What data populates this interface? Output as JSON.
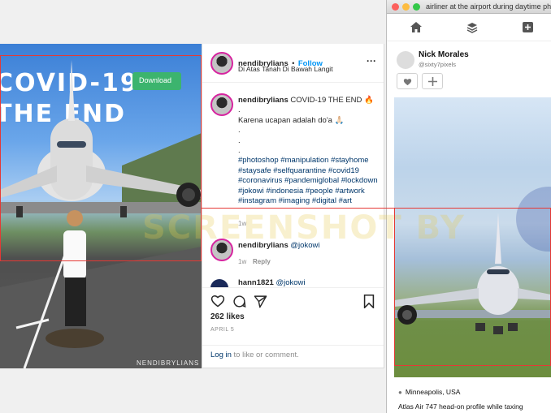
{
  "instagram": {
    "image_title_line1": "COVID-19",
    "image_title_line2": "THE END",
    "image_watermark": "NENDIBRYLIANS",
    "header": {
      "username": "nendibrylians",
      "follow_label": "Follow",
      "separator": "•",
      "location": "Di Atas Tanah Di Bawah Langit"
    },
    "caption": {
      "username": "nendibrylians",
      "text1": "COVID-19 THE END 🔥",
      "dot1": ".",
      "text2": "Karena ucapan adalah do'a 🙏🏻",
      "dot2": ".",
      "dot3": ".",
      "dot4": ".",
      "hashtags": "#photoshop #manipulation #stayhome #staysafe #selfquarantine #covid19 #coronavirus #pandemiglobal #lockdown #jokowi #indonesia #people #artwork #instagram #imaging #digital #art",
      "age": "1w"
    },
    "comment1": {
      "username": "nendibrylians",
      "mention": "@jokowi",
      "age": "1w",
      "reply_label": "Reply"
    },
    "comment2": {
      "username": "hann1821",
      "mention": "@jokowi"
    },
    "likes": "262 likes",
    "date": "APRIL 5",
    "login_link": "Log in",
    "login_text": " to like or comment."
  },
  "mac_window": {
    "title": "airliner at the airport during daytime photo",
    "author_name": "Nick Morales",
    "author_handle": "@sixty7pixels",
    "download_label": "Download",
    "location": "Minneapolis, USA",
    "description": "Atlas Air 747 head-on profile while taxing"
  },
  "watermark": "SCREENSHOT BY",
  "colors": {
    "highlight_red": "#e53935",
    "ig_blue": "#0095f6",
    "download_green": "#3cb46e"
  }
}
